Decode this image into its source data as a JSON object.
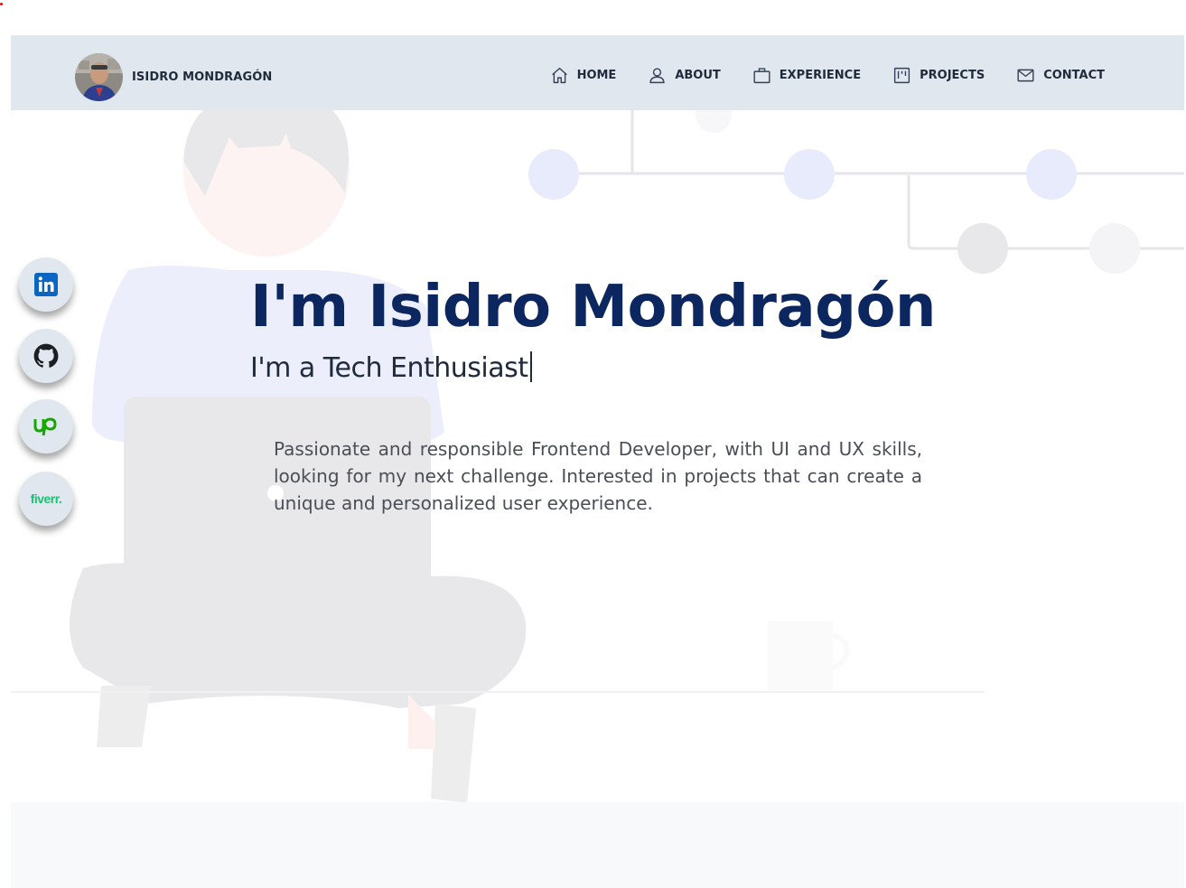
{
  "brand": {
    "name": "ISIDRO MONDRAGÓN"
  },
  "nav": [
    {
      "label": "HOME",
      "icon": "home-icon"
    },
    {
      "label": "ABOUT",
      "icon": "user-icon"
    },
    {
      "label": "EXPERIENCE",
      "icon": "briefcase-icon"
    },
    {
      "label": "PROJECTS",
      "icon": "kanban-board-icon"
    },
    {
      "label": "CONTACT",
      "icon": "mail-icon"
    }
  ],
  "social": [
    {
      "icon": "linkedin-icon",
      "color": "#0a66c2"
    },
    {
      "icon": "github-icon",
      "color": "#1b1f23"
    },
    {
      "icon": "upwork-icon",
      "color": "#14a800"
    },
    {
      "icon": "fiverr-icon",
      "color": "#1dbf73",
      "text": "fiverr."
    }
  ],
  "hero": {
    "title": "I'm Isidro Mondragón",
    "subtitle": "I'm a Tech Enthusiast",
    "description": "Passionate and responsible Frontend Developer, with UI and UX skills, looking for my next challenge. Interested in projects that can create a unique and personalized user experience."
  },
  "colors": {
    "header_bg": "#e1e7ef",
    "title": "#0c2660",
    "text": "#4a4f57"
  }
}
